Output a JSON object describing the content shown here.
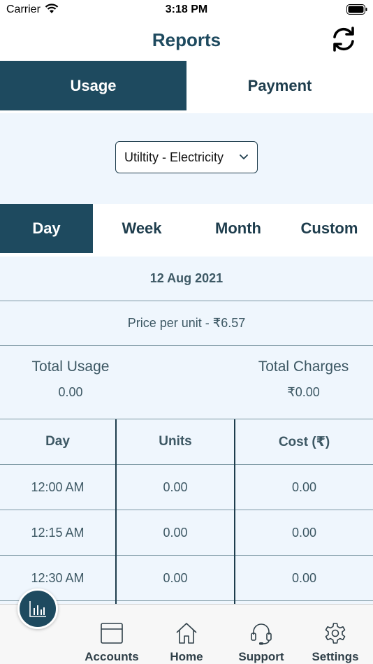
{
  "status_bar": {
    "carrier": "Carrier",
    "time": "3:18 PM"
  },
  "header": {
    "title": "Reports"
  },
  "main_tabs": [
    {
      "label": "Usage",
      "active": true
    },
    {
      "label": "Payment",
      "active": false
    }
  ],
  "utility_select": {
    "value": "Utiltity - Electricity"
  },
  "period_tabs": [
    {
      "label": "Day",
      "active": true
    },
    {
      "label": "Week",
      "active": false
    },
    {
      "label": "Month",
      "active": false
    },
    {
      "label": "Custom",
      "active": false
    }
  ],
  "summary": {
    "date": "12 Aug 2021",
    "price_per_unit": "Price per unit - ₹6.57",
    "total_usage_label": "Total Usage",
    "total_usage_value": "0.00",
    "total_charges_label": "Total Charges",
    "total_charges_value": "₹0.00"
  },
  "table": {
    "headers": [
      "Day",
      "Units",
      "Cost (₹)"
    ],
    "rows": [
      [
        "12:00 AM",
        "0.00",
        "0.00"
      ],
      [
        "12:15 AM",
        "0.00",
        "0.00"
      ],
      [
        "12:30 AM",
        "0.00",
        "0.00"
      ]
    ]
  },
  "bottom_nav": [
    {
      "label": "Accounts",
      "icon": "accounts-icon"
    },
    {
      "label": "Home",
      "icon": "home-icon"
    },
    {
      "label": "Support",
      "icon": "headset-icon"
    },
    {
      "label": "Settings",
      "icon": "gear-icon"
    }
  ],
  "colors": {
    "primary": "#1e4a5f",
    "panel": "#eff6fd",
    "divider": "#7d98a4"
  }
}
